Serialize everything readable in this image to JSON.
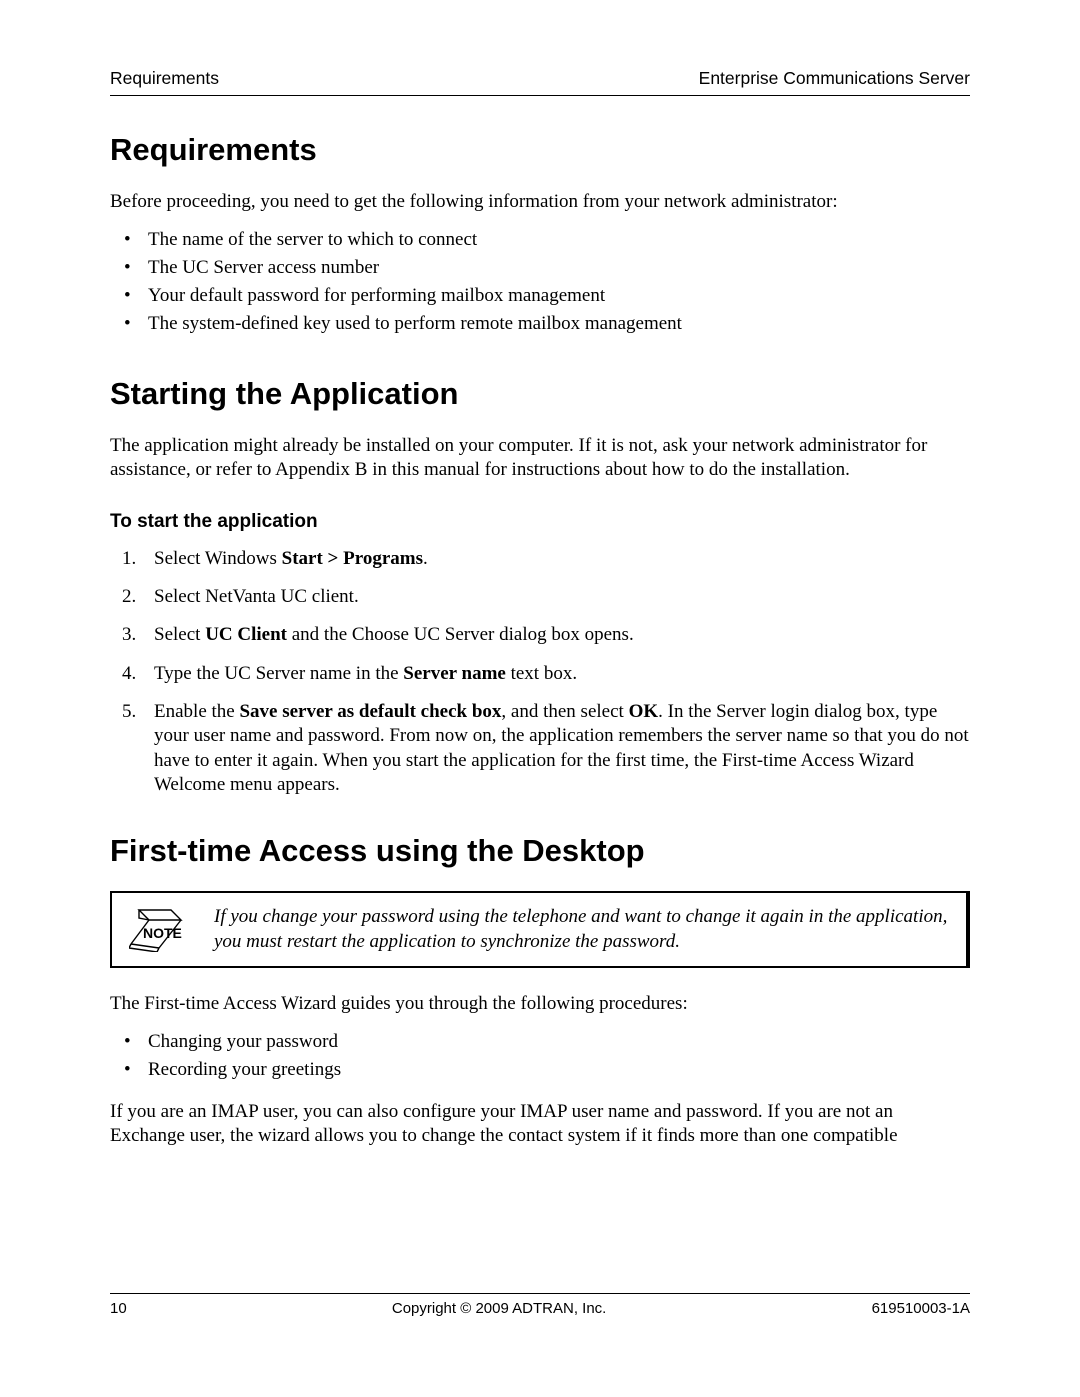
{
  "header": {
    "left": "Requirements",
    "right": "Enterprise Communications Server"
  },
  "sec1": {
    "title": "Requirements",
    "intro": "Before proceeding, you need to get the following information from your network administrator:",
    "bullets": [
      "The name of the server to which to connect",
      "The UC Server access number",
      "Your default password for performing mailbox management",
      "The system-defined key used to perform remote mailbox management"
    ]
  },
  "sec2": {
    "title": "Starting the Application",
    "intro": "The application might already be installed on your computer. If it is not, ask your network administrator for assistance, or refer to Appendix B in this manual for instructions about how to do the installation.",
    "subhead": "To start the application",
    "step1_a": "Select Windows ",
    "step1_b": "Start > Programs",
    "step1_c": ".",
    "step2": "Select NetVanta UC client.",
    "step3_a": "Select ",
    "step3_b": "UC Client",
    "step3_c": " and the Choose UC Server dialog box opens.",
    "step4_a": "Type the UC Server name in the ",
    "step4_b": "Server name",
    "step4_c": " text box.",
    "step5_a": "Enable the ",
    "step5_b": "Save server as default check box",
    "step5_c": ", and then select ",
    "step5_d": "OK",
    "step5_e": ". In the Server login dialog box, type your user name and password. From now on, the application remembers the server name so that you do not have to enter it again. When you start the application for the first time, the First-time Access Wizard Welcome menu appears."
  },
  "sec3": {
    "title": "First-time Access using the Desktop",
    "note_label": "NOTE",
    "note": "If you change your password using the telephone and want to change it again in the application, you must restart the application to synchronize the password.",
    "lead": "The First-time Access Wizard guides you through the following procedures:",
    "bullets": [
      "Changing your password",
      "Recording your greetings"
    ],
    "tail": "If you are an IMAP user, you can also configure your IMAP user name and password. If you are not an Exchange user, the wizard allows you to change the contact system if it finds more than one compatible"
  },
  "footer": {
    "left": "10",
    "center": "Copyright © 2009 ADTRAN, Inc.",
    "right": "619510003-1A"
  }
}
